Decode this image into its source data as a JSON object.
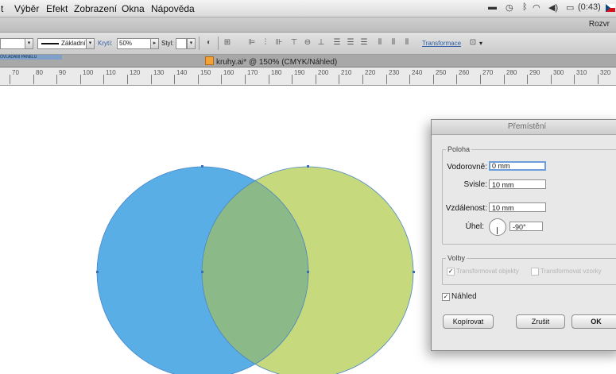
{
  "menubar": {
    "items": [
      "t",
      "Výběr",
      "Efekt",
      "Zobrazení",
      "Okna",
      "Nápověda"
    ],
    "clock": "(0:43)"
  },
  "appbar": {
    "right_label": "Rozvr"
  },
  "controlbar": {
    "stroke_style": "Základní",
    "opacity_label": "Krytí:",
    "opacity_value": "50%",
    "style_label": "Styl:",
    "transform_label": "Transformace"
  },
  "document": {
    "tab_title": "kruhy.ai* @ 150% (CMYK/Náhled)",
    "left_tag": "OVLÁDÁNÍ PANELU"
  },
  "ruler": {
    "labels": [
      "70",
      "80",
      "90",
      "100",
      "110",
      "120",
      "130",
      "140",
      "150",
      "160",
      "170",
      "180",
      "190",
      "200",
      "210",
      "220",
      "230",
      "240",
      "250",
      "260",
      "270",
      "280",
      "290",
      "300",
      "310",
      "320"
    ]
  },
  "canvas": {
    "circle_left_color": "#5aaee6",
    "circle_right_color": "#c6d97c",
    "overlap_color": "#8bb987"
  },
  "dialog": {
    "title": "Přemístění",
    "position_group": "Poloha",
    "horizontal_label": "Vodorovně:",
    "horizontal_value": "0 mm",
    "vertical_label": "Svisle:",
    "vertical_value": "10 mm",
    "distance_label": "Vzdálenost:",
    "distance_value": "10 mm",
    "angle_label": "Úhel:",
    "angle_value": "-90°",
    "options_group": "Volby",
    "option1": "Transformovat objekty",
    "option2": "Transformovat vzorky",
    "preview_label": "Náhled",
    "preview_checked": true,
    "copy_button": "Kopírovat",
    "cancel_button": "Zrušit",
    "ok_button": "OK"
  }
}
